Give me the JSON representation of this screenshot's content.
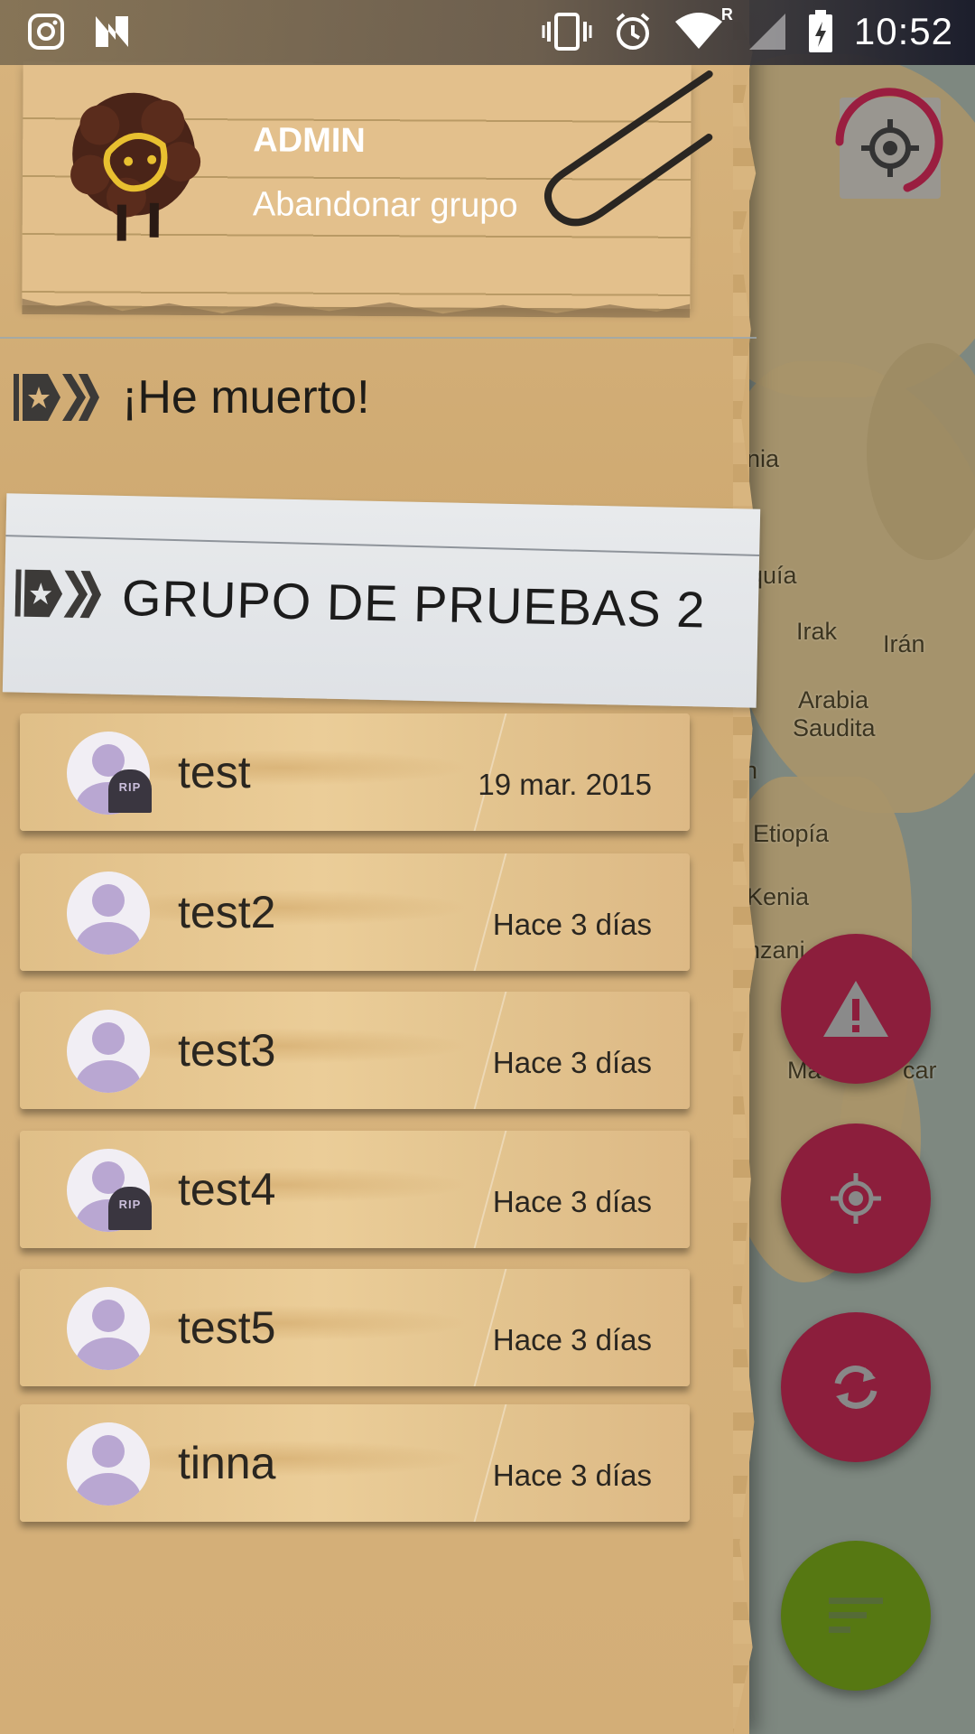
{
  "status_bar": {
    "time": "10:52",
    "icons": [
      "instagram-icon",
      "n-icon",
      "vibrate-icon",
      "alarm-icon",
      "wifi-icon",
      "signal-icon",
      "battery-icon"
    ],
    "roaming": "R"
  },
  "drawer": {
    "header": {
      "user_name": "ADMIN",
      "leave_group": "Abandonar grupo"
    },
    "dead_action": "¡He muerto!",
    "group_name": "GRUPO DE PRUEBAS 2",
    "members": [
      {
        "name": "test",
        "last_seen": "19 mar. 2015",
        "dead": true
      },
      {
        "name": "test2",
        "last_seen": "Hace 3 días",
        "dead": false
      },
      {
        "name": "test3",
        "last_seen": "Hace 3 días",
        "dead": false
      },
      {
        "name": "test4",
        "last_seen": "Hace 3 días",
        "dead": true
      },
      {
        "name": "test5",
        "last_seen": "Hace 3 días",
        "dead": false
      },
      {
        "name": "tinna",
        "last_seen": "Hace 3 días",
        "dead": false
      }
    ],
    "rip_label": "RIP"
  },
  "map": {
    "labels": [
      "ania",
      "quía",
      "Irak",
      "Irán",
      "Arabia",
      "Saudita",
      "n",
      "Etiopía",
      "Kenia",
      "anzani",
      "Ma",
      "car"
    ]
  },
  "colors": {
    "fab_red": "#8c1e3c",
    "fab_green": "#567812",
    "avatar_purple": "#b9a7d2"
  }
}
